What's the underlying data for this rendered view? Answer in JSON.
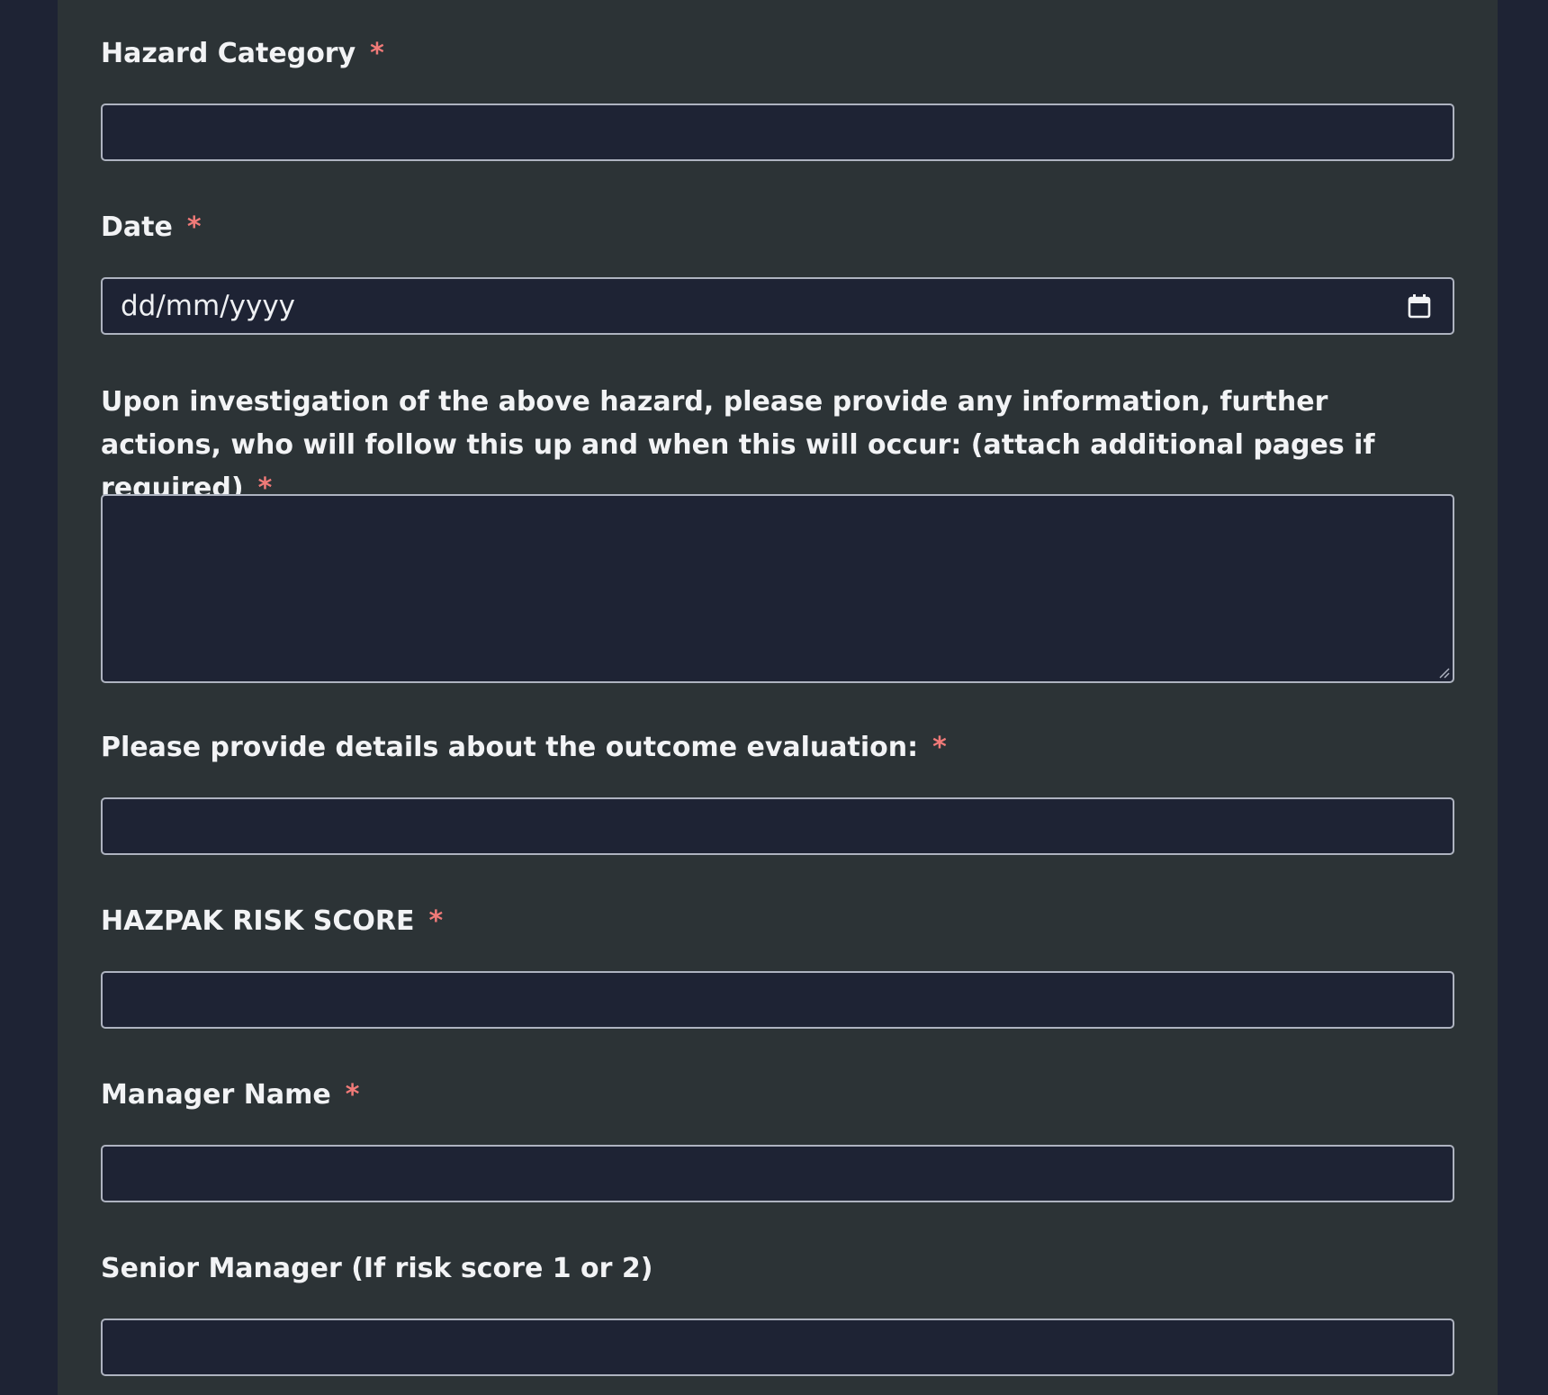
{
  "form": {
    "hazard_category": {
      "label": "Hazard Category",
      "required_mark": "*",
      "value": ""
    },
    "date": {
      "label": "Date",
      "required_mark": "*",
      "placeholder": "dd/mm/yyyy"
    },
    "investigation": {
      "label": "Upon investigation of the above hazard, please provide any information, further actions, who will follow this up and when this will occur: (attach additional pages if required)",
      "required_mark": "*",
      "value": ""
    },
    "outcome": {
      "label": "Please provide details about the outcome evaluation:",
      "required_mark": "*",
      "value": ""
    },
    "risk_score": {
      "label": "HAZPAK RISK SCORE",
      "required_mark": "*",
      "value": ""
    },
    "manager_name": {
      "label": "Manager Name",
      "required_mark": "*",
      "value": ""
    },
    "senior_manager": {
      "label": "Senior Manager (If risk score 1 or 2)",
      "value": ""
    }
  },
  "icons": {
    "date_picker": "calendar-icon",
    "textarea_resize": "resize-grip-icon"
  },
  "colors": {
    "page_background": "#1e2334",
    "panel_background": "#2c3336",
    "input_background": "#1e2334",
    "input_border": "#aeb3c0",
    "required_asterisk": "#f07a78",
    "label_text": "#f2f3f5"
  }
}
